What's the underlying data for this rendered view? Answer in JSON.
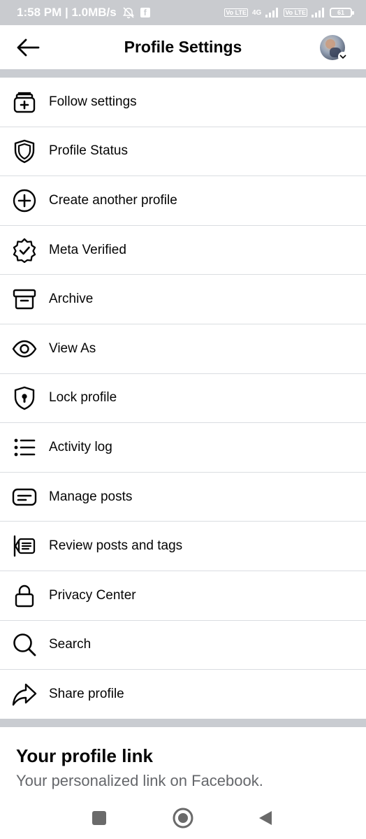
{
  "status_bar": {
    "time_info": "1:58 PM | 1.0MB/s",
    "fb_badge": "f",
    "network": "4G",
    "vo_label": "Vo LTE",
    "battery": "61"
  },
  "header": {
    "title": "Profile Settings"
  },
  "menu": {
    "items": [
      {
        "label": "Follow settings",
        "icon": "follow-settings-icon"
      },
      {
        "label": "Profile Status",
        "icon": "shield-icon"
      },
      {
        "label": "Create another profile",
        "icon": "plus-circle-icon"
      },
      {
        "label": "Meta Verified",
        "icon": "verified-badge-icon"
      },
      {
        "label": "Archive",
        "icon": "archive-icon"
      },
      {
        "label": "View As",
        "icon": "eye-icon"
      },
      {
        "label": "Lock profile",
        "icon": "lock-shield-icon"
      },
      {
        "label": "Activity log",
        "icon": "list-icon"
      },
      {
        "label": "Manage posts",
        "icon": "manage-posts-icon"
      },
      {
        "label": "Review posts and tags",
        "icon": "review-posts-icon"
      },
      {
        "label": "Privacy Center",
        "icon": "padlock-icon"
      },
      {
        "label": "Search",
        "icon": "search-icon"
      },
      {
        "label": "Share profile",
        "icon": "share-icon"
      }
    ]
  },
  "profile_link": {
    "title": "Your profile link",
    "subtitle": "Your personalized link on Facebook."
  },
  "colors": {
    "status_bar_bg": "#c9cbcf",
    "divider": "#c9ccd1",
    "text_primary": "#050505",
    "text_secondary": "#65676b",
    "nav_icon": "#6a6a6a"
  }
}
